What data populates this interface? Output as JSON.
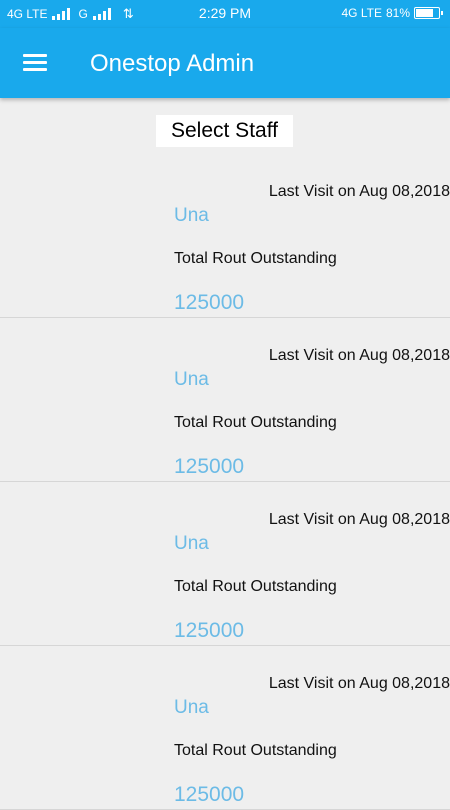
{
  "status_bar": {
    "network_left": "4G LTE",
    "network_g": "G",
    "time": "2:29 PM",
    "network_right": "4G LTE",
    "battery_percent": "81%",
    "battery_level": 0.81
  },
  "app_bar": {
    "title": "Onestop Admin",
    "menu_icon": "hamburger-menu-icon"
  },
  "select_staff_label": "Select Staff",
  "staff_cards": [
    {
      "last_visit": "Last Visit on Aug 08,2018",
      "name": "Una",
      "outstanding_label": "Total Rout Outstanding",
      "outstanding_value": "125000"
    },
    {
      "last_visit": "Last Visit on Aug 08,2018",
      "name": "Una",
      "outstanding_label": "Total Rout Outstanding",
      "outstanding_value": "125000"
    },
    {
      "last_visit": "Last Visit on Aug 08,2018",
      "name": "Una",
      "outstanding_label": "Total Rout Outstanding",
      "outstanding_value": "125000"
    },
    {
      "last_visit": "Last Visit on Aug 08,2018",
      "name": "Una",
      "outstanding_label": "Total Rout Outstanding",
      "outstanding_value": "125000"
    }
  ],
  "colors": {
    "primary": "#19a9ec",
    "accent_text": "#6cbbe6",
    "background": "#efefef"
  }
}
